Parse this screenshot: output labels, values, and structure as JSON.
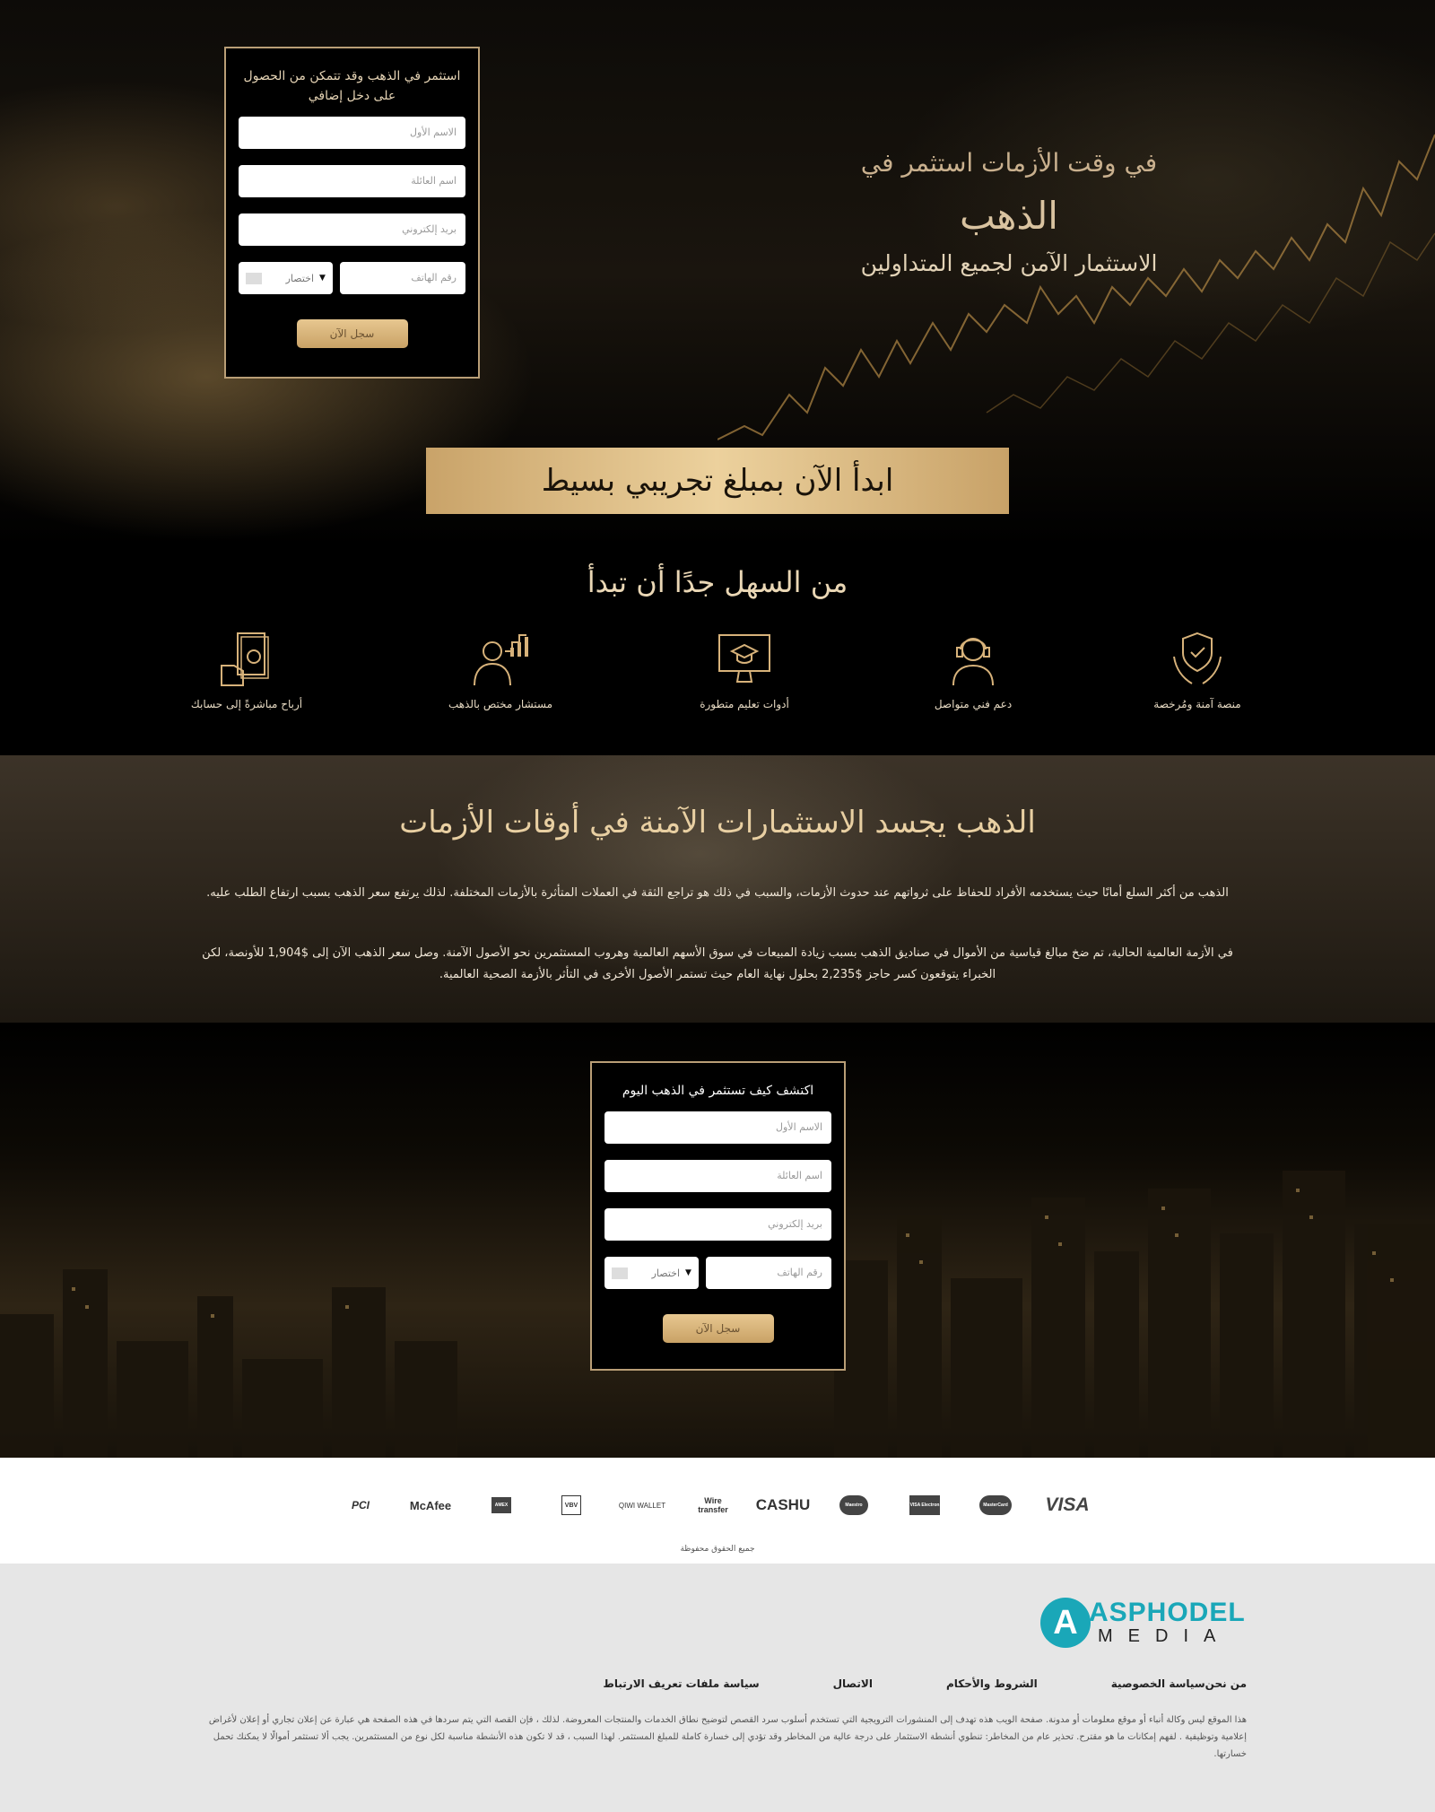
{
  "hero": {
    "line1": "في وقت الأزمات استثمر في",
    "line2": "الذهب",
    "line3": "الاستثمار الآمن لجميع المتداولين",
    "cta": "ابدأ الآن بمبلغ تجريبي بسيط"
  },
  "form_top": {
    "title": "استثمر في الذهب وقد تتمكن من الحصول على دخل إضافي",
    "first_name_placeholder": "الاسم الأول",
    "last_name_placeholder": "اسم العائلة",
    "email_placeholder": "بريد إلكتروني",
    "phone_placeholder": "رقم الهاتف",
    "country_label": "اختصار",
    "submit": "سجل الآن"
  },
  "features": {
    "title": "من السهل جدًا أن تبدأ",
    "items": [
      {
        "label": "منصة آمنة ومُرخصة",
        "icon": "shield-hands-icon"
      },
      {
        "label": "دعم فني متواصل",
        "icon": "support-agent-icon"
      },
      {
        "label": "أدوات تعليم متطورة",
        "icon": "education-monitor-icon"
      },
      {
        "label": "مستشار مختص بالذهب",
        "icon": "advisor-chart-icon"
      },
      {
        "label": "أرباح مباشرةً إلى حسابك",
        "icon": "money-hand-icon"
      }
    ]
  },
  "about": {
    "title": "الذهب يجسد الاستثمارات الآمنة في أوقات الأزمات",
    "p1": "الذهب من أكثر السلع أمانًا حيث يستخدمه الأفراد للحفاظ على ثرواتهم عند حدوث الأزمات، والسبب في ذلك هو تراجع الثقة في العملات المتأثرة بالأزمات المختلفة. لذلك يرتفع سعر الذهب بسبب ارتفاع الطلب عليه.",
    "p2": "في الأزمة العالمية الحالية، تم ضخ مبالغ قياسية من الأموال في صناديق الذهب بسبب زيادة المبيعات في سوق الأسهم العالمية وهروب المستثمرين نحو الأصول الآمنة. وصل سعر الذهب الآن إلى $1,904 للأونصة، لكن الخبراء يتوقعون كسر حاجز $2,235 بحلول نهاية العام حيث تستمر الأصول الأخرى في التأثر بالأزمة الصحية العالمية."
  },
  "form_bottom": {
    "title": "اكتشف كيف تستثمر في الذهب اليوم",
    "first_name_placeholder": "الاسم الأول",
    "last_name_placeholder": "اسم العائلة",
    "email_placeholder": "بريد إلكتروني",
    "phone_placeholder": "رقم الهاتف",
    "country_label": "اختصار",
    "submit": "سجل الآن"
  },
  "payments": {
    "logos": [
      "PCI",
      "McAfee",
      "AMEX",
      "VBV",
      "QIWI WALLET",
      "Wire transfer",
      "CASHU",
      "Maestro",
      "VISA Electron",
      "MasterCard",
      "VISA"
    ],
    "copyright": "جميع الحقوق محفوظة"
  },
  "footer": {
    "logo_letter": "A",
    "logo_brand": "ASPHODEL",
    "logo_sub": "MEDIA",
    "links": [
      "من نحن",
      "سياسة الخصوصية",
      "الشروط والأحكام",
      "الاتصال",
      "سياسة ملفات تعريف الارتباط"
    ],
    "disclaimer": "هذا الموقع ليس وكالة أنباء أو موقع معلومات أو مدونة. صفحة الويب هذه تهدف إلى المنشورات الترويجية التي تستخدم أسلوب سرد القصص لتوضيح نطاق الخدمات والمنتجات المعروضة. لذلك ، فإن القصة التي يتم سردها في هذه الصفحة هي عبارة عن إعلان تجاري أو إعلان لأغراض إعلامية وتوظيفية . لفهم إمكانات ما هو مقترح. تحذير عام من المخاطر: تنطوي أنشطة الاستثمار على درجة عالية من المخاطر وقد تؤدي إلى خسارة كاملة للمبلغ المستثمر. لهذا السبب ، قد لا تكون هذه الأنشطة مناسبة لكل نوع من المستثمرين. يجب ألا تستثمر أموالًا لا يمكنك تحمل خسارتها."
  },
  "colors": {
    "gold": "#c9a369",
    "gold_light": "#ecd19d",
    "brand_teal": "#1aa7b8"
  }
}
